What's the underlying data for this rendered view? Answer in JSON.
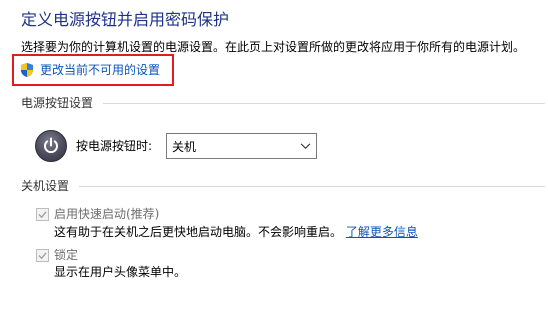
{
  "header": {
    "title": "定义电源按钮并启用密码保护",
    "description": "选择要为你的计算机设置的电源设置。在此页上对设置所做的更改将应用于你所有的电源计划。"
  },
  "change_settings_link": {
    "label": "更改当前不可用的设置",
    "icon": "uac-shield-icon"
  },
  "power_button_section": {
    "heading": "电源按钮设置",
    "icon": "power-button-icon",
    "field_label": "按电源按钮时:",
    "selected_value": "关机"
  },
  "shutdown_section": {
    "heading": "关机设置",
    "items": [
      {
        "label": "启用快速启动(推荐)",
        "checked": true,
        "enabled": false,
        "description": "这有助于在关机之后更快地启动电脑。不会影响重启。",
        "link": "了解更多信息"
      },
      {
        "label": "锁定",
        "checked": true,
        "enabled": false,
        "description": "显示在用户头像菜单中。"
      }
    ]
  },
  "colors": {
    "title": "#1e3287",
    "link": "#0b54b8",
    "highlight_border": "#e11d1d",
    "disabled_text": "#6d6d6d"
  }
}
